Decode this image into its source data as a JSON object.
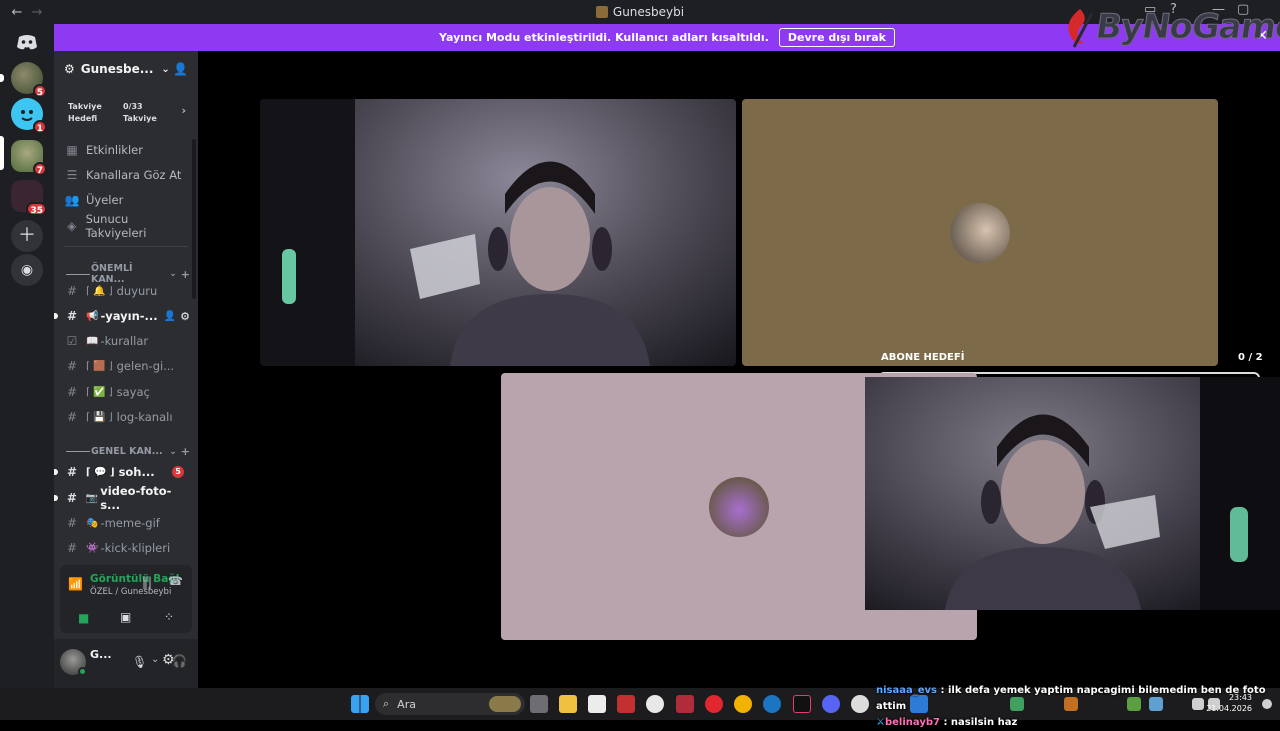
{
  "window": {
    "title": "Gunesbeybi",
    "back": "←",
    "forward": "→"
  },
  "banner": {
    "text": "Yayıncı Modu etkinleştirildi. Kullanıcı adları kısaltıldı.",
    "button": "Devre dışı bırak",
    "close": "✕"
  },
  "overlay_logo": {
    "text": "ByNoGame"
  },
  "guilds": [
    {
      "badge": "5"
    },
    {
      "badge": "1"
    },
    {
      "badge": "7"
    },
    {
      "badge": "35"
    }
  ],
  "server": {
    "name": "Gunesbe...",
    "chevron": "⌄"
  },
  "boost": {
    "goal_label_1": "Takviye",
    "goal_label_2": "Hedefi",
    "count": "0/33",
    "count_label": "Takviye",
    "arrow": "›"
  },
  "menu": [
    {
      "label": "Etkinlikler"
    },
    {
      "label": "Kanallara Göz At"
    },
    {
      "label": "Üyeler"
    },
    {
      "label": "Sunucu Takviyeleri"
    }
  ],
  "categories": [
    {
      "label": "ÖNEMLİ KAN..."
    },
    {
      "label": "GENEL KAN..."
    }
  ],
  "channels_important": [
    {
      "name": "duyuru",
      "prefix": "⌈ 🔔 ⌋"
    },
    {
      "name": "-yayın-...",
      "prefix": "📢"
    },
    {
      "name": "-kurallar",
      "prefix": "📖"
    },
    {
      "name": "gelen-gi...",
      "prefix": "⌈ 🟫 ⌋"
    },
    {
      "name": "sayaç",
      "prefix": "⌈ ✅ ⌋"
    },
    {
      "name": "log-kanalı",
      "prefix": "⌈ 💾 ⌋"
    }
  ],
  "channels_general": [
    {
      "name": "soh...",
      "prefix": "⌈ 💬 ⌋",
      "mentions": "5"
    },
    {
      "name": "video-foto-s...",
      "prefix": "📷"
    },
    {
      "name": "-meme-gif",
      "prefix": "🎭"
    },
    {
      "name": "-kick-klipleri",
      "prefix": "👾"
    }
  ],
  "voice": {
    "status": "Görüntülü Bağl",
    "channel": "ÖZEL / Gunesbeybi"
  },
  "user": {
    "name": "G..."
  },
  "stream": {
    "goal_label": "ABONE HEDEFİ",
    "goal_count": "0 / 2",
    "goal_progress": 0.0
  },
  "taskbar": {
    "search": "Ara",
    "time": "23:43",
    "date": "21.04.2026"
  },
  "chat": [
    {
      "user": "nisaaa_evs",
      "message": ": ilk defa yemek yaptim napcagimi bilemedim ben de foto attim"
    },
    {
      "user": "belinayb7",
      "message": ": nasilsin haz"
    }
  ],
  "colors": {
    "banner": "#8e3af2",
    "voice_connected": "#23a55a",
    "mention": "#da373c",
    "tile_brown": "#7d6a48",
    "tile_pink": "#b9a3ad"
  }
}
